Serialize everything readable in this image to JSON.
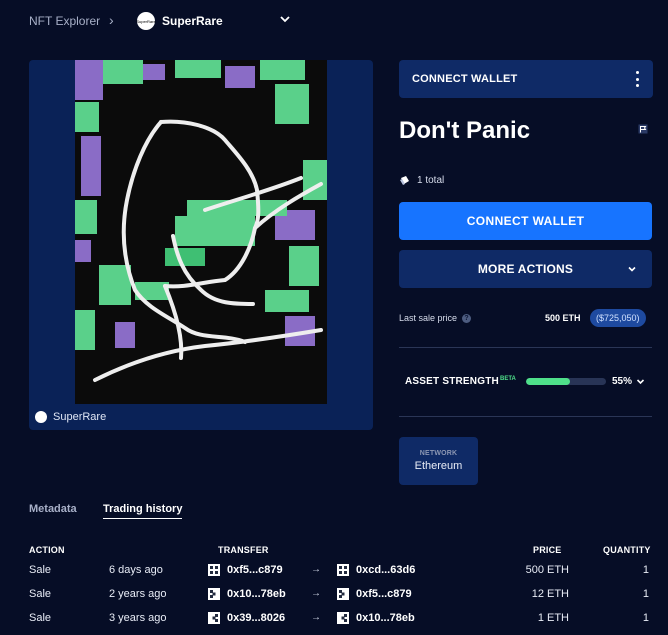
{
  "header": {
    "root": "NFT Explorer",
    "collection": "SuperRare",
    "collection_logo_text": "SuperRare"
  },
  "artwork": {
    "source_label": "SuperRare"
  },
  "wallet_bar": {
    "label": "CONNECT WALLET"
  },
  "asset": {
    "title": "Don't Panic",
    "owners": "1 total"
  },
  "actions": {
    "connect": "CONNECT WALLET",
    "more": "MORE ACTIONS"
  },
  "sale": {
    "label": "Last sale price",
    "eth": "500 ETH",
    "usd": "($725,050)"
  },
  "strength": {
    "label": "ASSET STRENGTH",
    "beta": "BETA",
    "percent_text": "55%",
    "value": 0.55
  },
  "network": {
    "label": "NETWORK",
    "value": "Ethereum"
  },
  "tabs": {
    "metadata": "Metadata",
    "trading": "Trading history"
  },
  "table": {
    "headers": {
      "action": "ACTION",
      "transfer": "TRANSFER",
      "price": "PRICE",
      "quantity": "QUANTITY"
    },
    "rows": [
      {
        "action": "Sale",
        "time": "6 days ago",
        "from": "0xf5...c879",
        "to": "0xcd...63d6",
        "price": "500 ETH",
        "quantity": "1"
      },
      {
        "action": "Sale",
        "time": "2 years ago",
        "from": "0x10...78eb",
        "to": "0xf5...c879",
        "price": "12 ETH",
        "quantity": "1"
      },
      {
        "action": "Sale",
        "time": "3 years ago",
        "from": "0x39...8026",
        "to": "0x10...78eb",
        "price": "1 ETH",
        "quantity": "1"
      }
    ]
  },
  "colors": {
    "background": "#060d26",
    "card": "#0f2a66",
    "primary": "#1774ff",
    "strength": "#4fe08a"
  },
  "icons": {
    "crumb_separator": "chevron-right-icon",
    "collection_dropdown": "chevron-down-icon",
    "menu": "kebab-menu-icon",
    "report": "flag-icon",
    "owners": "owners-icon",
    "help": "help-icon",
    "transfer_arrow": "arrow-right-icon"
  }
}
